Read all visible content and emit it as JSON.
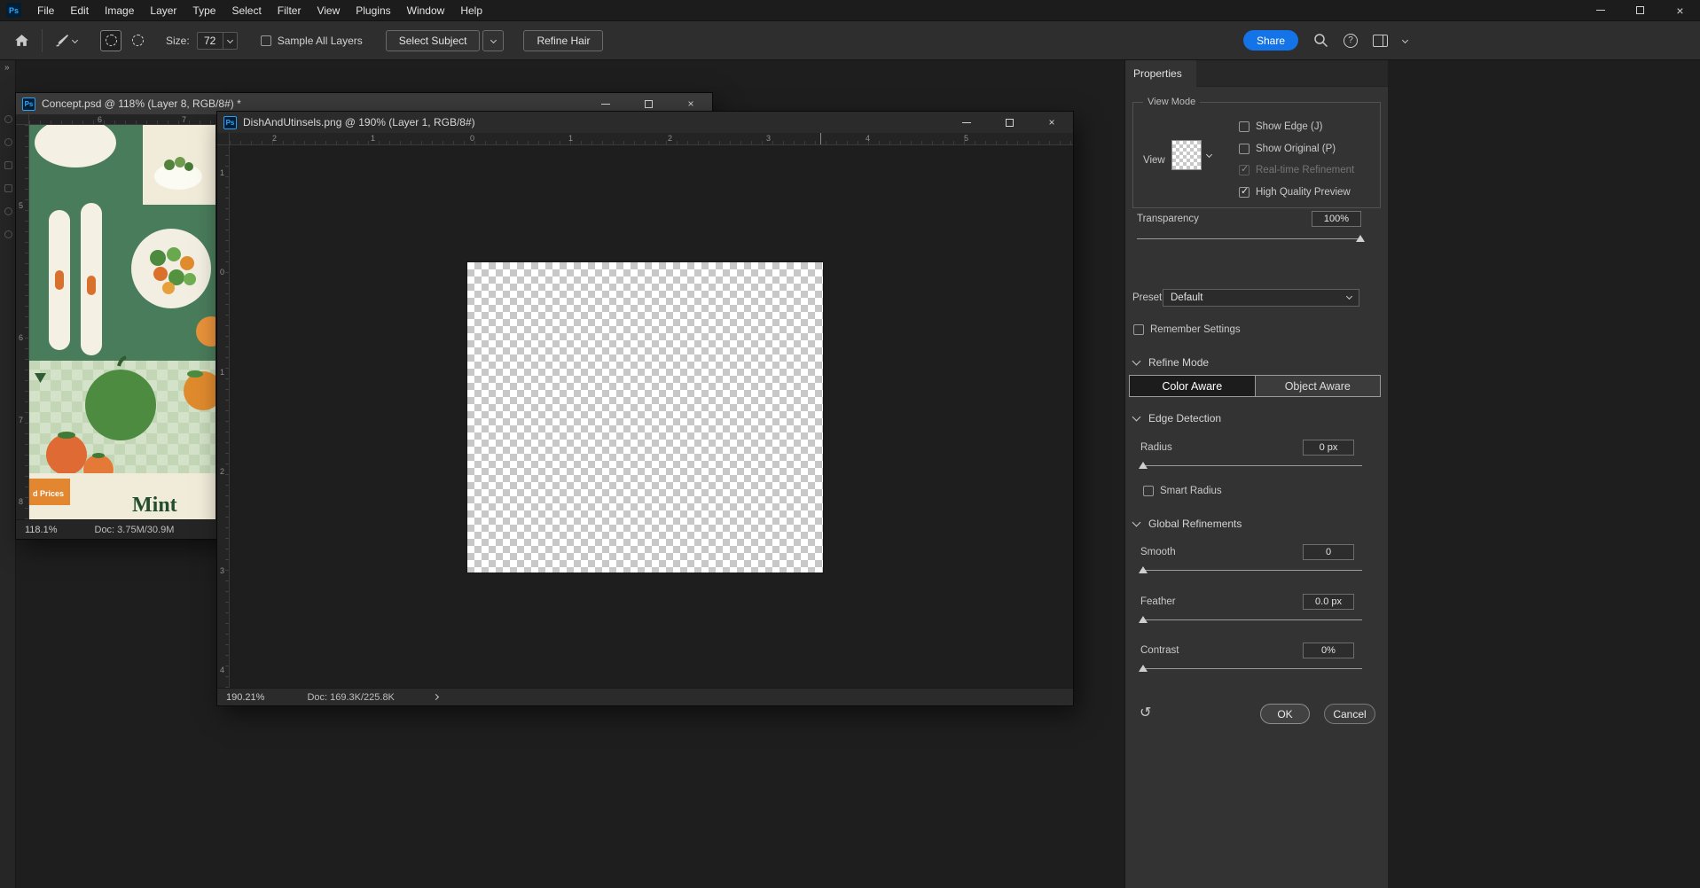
{
  "colors": {
    "accent_blue": "#1473e6",
    "ps_icon_blue": "#31a8ff",
    "panel_bg": "#333333",
    "canvas_bg": "#1e1e1e"
  },
  "menu_bar": {
    "app_icon": "Ps",
    "items": [
      "File",
      "Edit",
      "Image",
      "Layer",
      "Type",
      "Select",
      "Filter",
      "View",
      "Plugins",
      "Window",
      "Help"
    ]
  },
  "window_controls": {
    "minimize": "minimize",
    "maximize": "maximize",
    "close": "×"
  },
  "options_bar": {
    "size_label": "Size:",
    "size_value": "72",
    "sample_all_layers_label": "Sample All Layers",
    "select_subject_label": "Select Subject",
    "refine_hair_label": "Refine Hair",
    "share_label": "Share"
  },
  "documents": {
    "back": {
      "title": "Concept.psd @ 118% (Layer 8, RGB/8#) *",
      "zoom": "118.1%",
      "doc_info": "Doc: 3.75M/30.9M",
      "ruler_h": [
        "6",
        "7"
      ],
      "ruler_v": [
        "5",
        "6",
        "7",
        "8"
      ],
      "art": {
        "price_label": "d Prices",
        "brand": "Mint"
      }
    },
    "front": {
      "title": "DishAndUtinsels.png @ 190% (Layer 1, RGB/8#)",
      "zoom": "190.21%",
      "doc_info": "Doc: 169.3K/225.8K",
      "ruler_h": [
        "2",
        "1",
        "0",
        "1",
        "2",
        "3",
        "4",
        "5"
      ],
      "ruler_v": [
        "1",
        "0",
        "1",
        "2",
        "3",
        "4"
      ]
    }
  },
  "properties": {
    "tab": "Properties",
    "view_mode": {
      "title": "View Mode",
      "view_label": "View",
      "checkboxes": [
        {
          "label": "Show Edge (J)",
          "checked": false,
          "disabled": false
        },
        {
          "label": "Show Original (P)",
          "checked": false,
          "disabled": false
        },
        {
          "label": "Real-time Refinement",
          "checked": true,
          "disabled": true
        },
        {
          "label": "High Quality Preview",
          "checked": true,
          "disabled": false
        }
      ]
    },
    "transparency": {
      "label": "Transparency",
      "value": "100%"
    },
    "preset": {
      "label": "Preset",
      "value": "Default"
    },
    "remember_label": "Remember Settings",
    "refine_mode": {
      "title": "Refine Mode",
      "color_aware": "Color Aware",
      "object_aware": "Object Aware",
      "selected": "Color Aware"
    },
    "edge_detection": {
      "title": "Edge Detection",
      "radius_label": "Radius",
      "radius_value": "0 px",
      "smart_radius_label": "Smart Radius"
    },
    "global_refinements": {
      "title": "Global Refinements",
      "smooth_label": "Smooth",
      "smooth_value": "0",
      "feather_label": "Feather",
      "feather_value": "0.0 px",
      "contrast_label": "Contrast",
      "contrast_value": "0%"
    },
    "ok_label": "OK",
    "cancel_label": "Cancel"
  }
}
